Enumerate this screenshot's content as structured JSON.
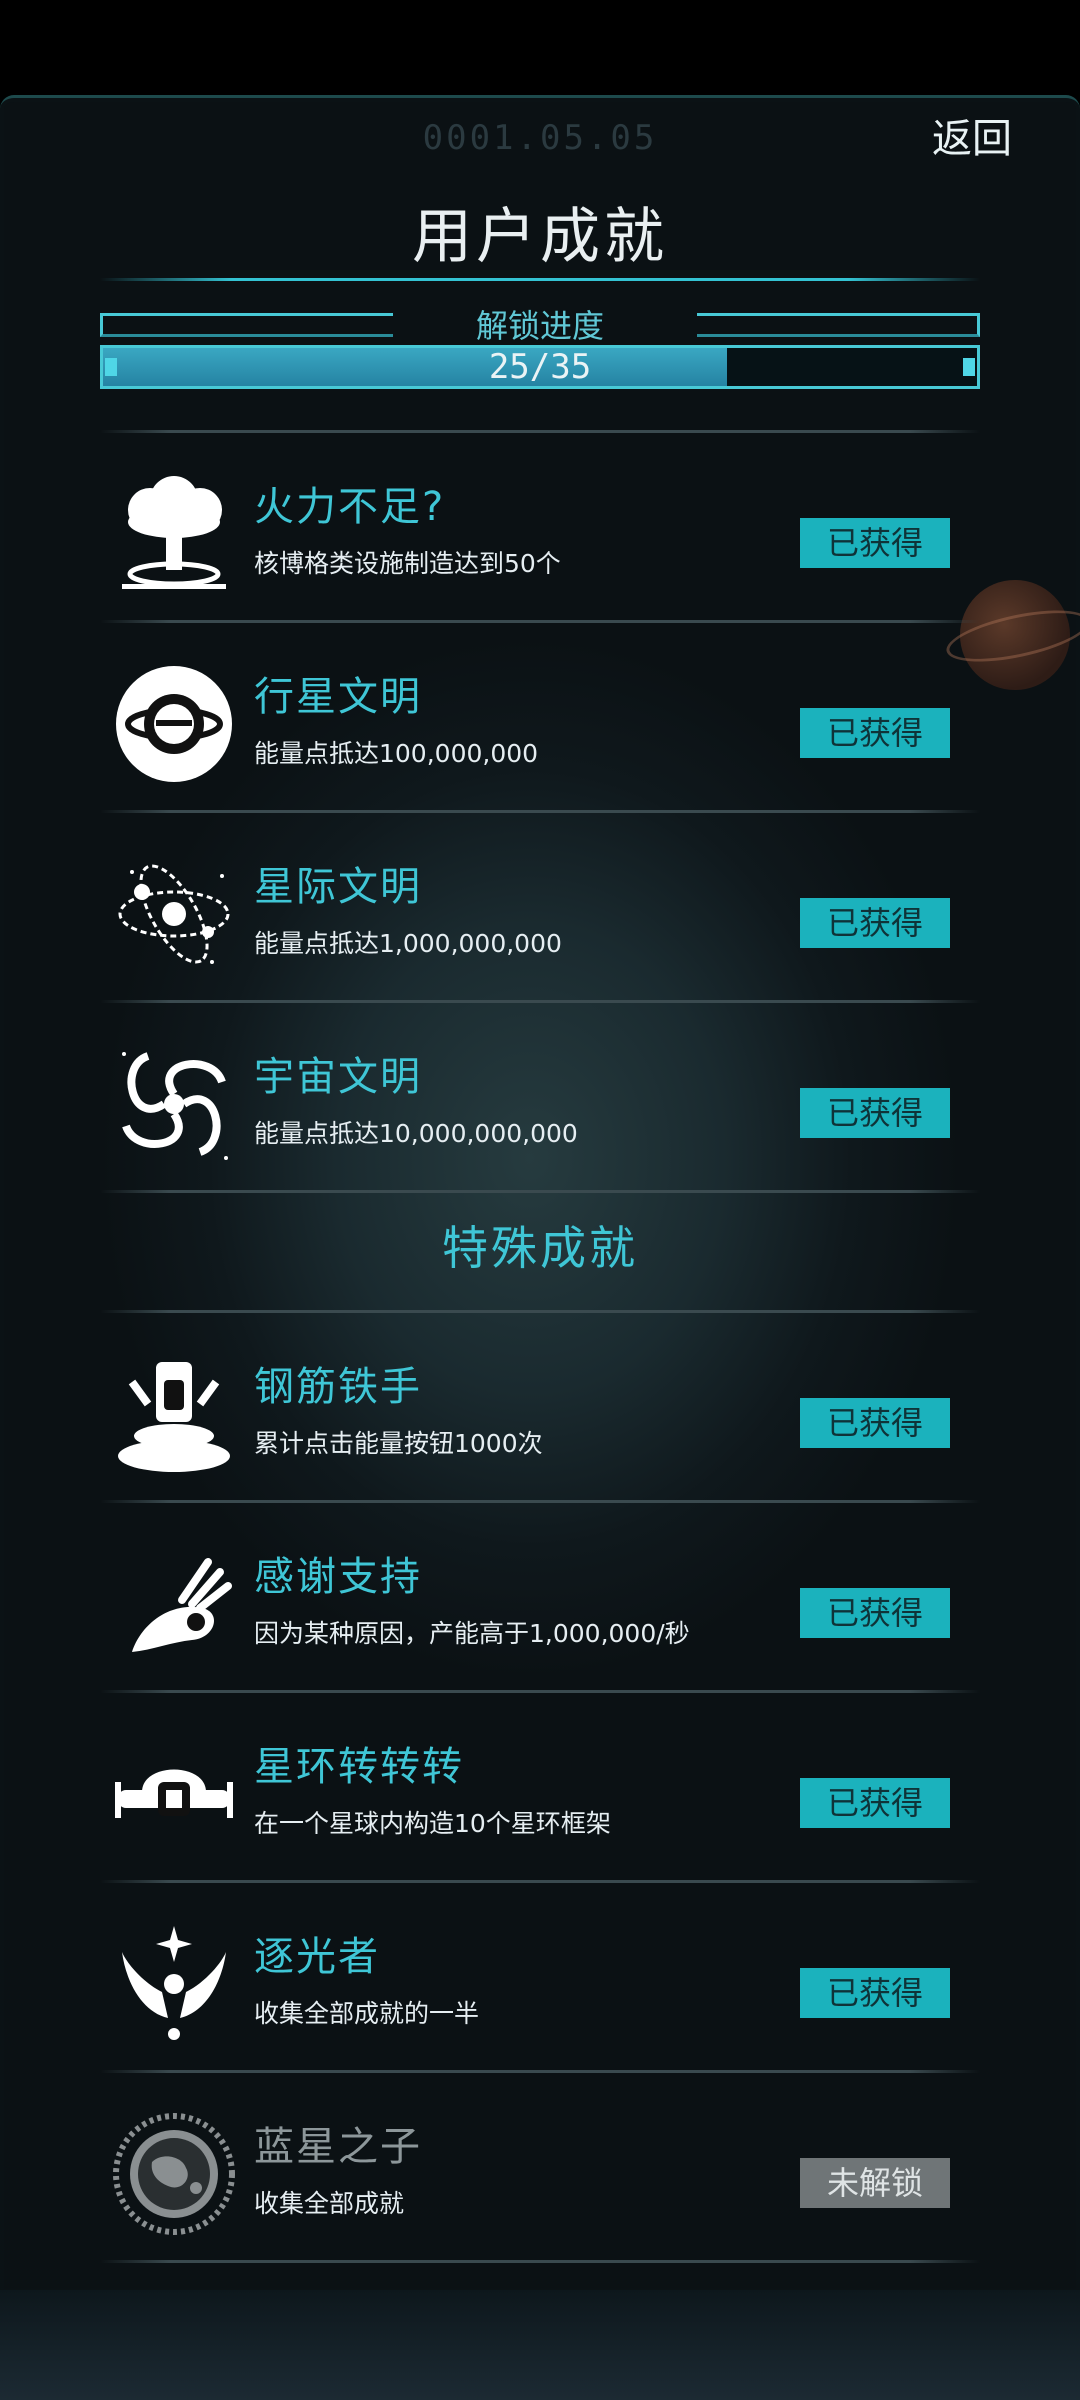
{
  "header": {
    "date": "0001.05.05",
    "back_label": "返回",
    "title": "用户成就"
  },
  "progress": {
    "label": "解锁进度",
    "unlocked": 25,
    "total": 35,
    "text": "25/35"
  },
  "colors": {
    "accent": "#3fc6d6",
    "badge_owned": "#1bb2bd",
    "badge_locked": "#6f7577"
  },
  "achievements": [
    {
      "name": "火力不足?",
      "desc": "核博格类设施制造达到50个",
      "status": "已获得",
      "icon": "mushroom-cloud-icon"
    },
    {
      "name": "行星文明",
      "desc": "能量点抵达100,000,000",
      "status": "已获得",
      "icon": "planet-icon"
    },
    {
      "name": "星际文明",
      "desc": "能量点抵达1,000,000,000",
      "status": "已获得",
      "icon": "atom-orbit-icon"
    },
    {
      "name": "宇宙文明",
      "desc": "能量点抵达10,000,000,000",
      "status": "已获得",
      "icon": "galaxy-swirl-icon"
    }
  ],
  "special_title": "特殊成就",
  "special": [
    {
      "name": "钢筋铁手",
      "desc": "累计点击能量按钮1000次",
      "status": "已获得",
      "icon": "press-button-icon"
    },
    {
      "name": "感谢支持",
      "desc": "因为某种原因，产能高于1,000,000/秒",
      "status": "已获得",
      "icon": "ok-hand-icon"
    },
    {
      "name": "星环转转转",
      "desc": "在一个星球内构造10个星环框架",
      "status": "已获得",
      "icon": "ring-frame-icon"
    },
    {
      "name": "逐光者",
      "desc": "收集全部成就的一半",
      "status": "已获得",
      "icon": "winged-emblem-icon"
    },
    {
      "name": "蓝星之子",
      "desc": "收集全部成就",
      "status": "未解锁",
      "icon": "earth-seal-icon"
    }
  ]
}
